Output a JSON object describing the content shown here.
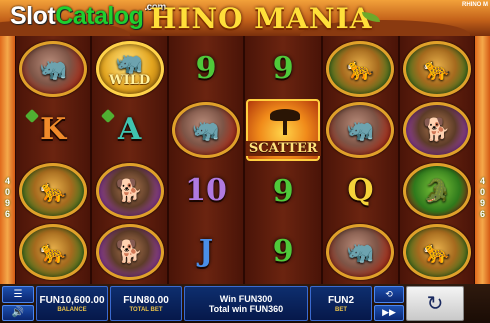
{
  "header": {
    "watermark_slot": "Slot",
    "watermark_catalog": "Catalog",
    "watermark_com": ".com",
    "game_title": "HINO MANIA",
    "corner_text": "RHINO M"
  },
  "side_numbers": {
    "left": [
      "4",
      "0",
      "9",
      "6"
    ],
    "right": [
      "4",
      "0",
      "9",
      "6"
    ]
  },
  "reels": [
    [
      {
        "kind": "coin",
        "animal": "rhino",
        "icon": "rhino-icon"
      },
      {
        "kind": "letter",
        "text": "K",
        "color": "orange"
      },
      {
        "kind": "coin",
        "animal": "leopard",
        "icon": "leopard-icon"
      },
      {
        "kind": "coin",
        "animal": "leopard",
        "icon": "leopard-icon"
      }
    ],
    [
      {
        "kind": "wild",
        "label": "WILD",
        "icon": "rhino-icon"
      },
      {
        "kind": "letter",
        "text": "A",
        "color": "teal"
      },
      {
        "kind": "coin",
        "animal": "dog",
        "icon": "wild-dog-icon"
      },
      {
        "kind": "coin",
        "animal": "dog",
        "icon": "wild-dog-icon"
      }
    ],
    [
      {
        "kind": "letter",
        "text": "9",
        "color": "green"
      },
      {
        "kind": "coin",
        "animal": "rhino",
        "icon": "rhino-icon"
      },
      {
        "kind": "letter",
        "text": "10",
        "color": "violet"
      },
      {
        "kind": "letter",
        "text": "J",
        "color": "blue"
      }
    ],
    [
      {
        "kind": "letter",
        "text": "9",
        "color": "green"
      },
      {
        "kind": "scatter",
        "label": "SCATTER",
        "icon": "acacia-tree-icon"
      },
      {
        "kind": "letter",
        "text": "9",
        "color": "green"
      },
      {
        "kind": "letter",
        "text": "9",
        "color": "green"
      }
    ],
    [
      {
        "kind": "coin",
        "animal": "leopard",
        "icon": "leopard-icon"
      },
      {
        "kind": "coin",
        "animal": "rhino",
        "icon": "rhino-icon"
      },
      {
        "kind": "letter",
        "text": "Q",
        "color": "yellow"
      },
      {
        "kind": "coin",
        "animal": "rhino",
        "icon": "rhino-icon"
      }
    ],
    [
      {
        "kind": "coin",
        "animal": "leopard",
        "icon": "leopard-icon"
      },
      {
        "kind": "coin",
        "animal": "dog",
        "icon": "wild-dog-icon"
      },
      {
        "kind": "coin",
        "animal": "croc",
        "icon": "crocodile-icon"
      },
      {
        "kind": "coin",
        "animal": "leopard",
        "icon": "leopard-icon"
      }
    ]
  ],
  "bar": {
    "balance_value": "FUN10,600.00",
    "balance_label": "BALANCE",
    "total_bet_value": "FUN80.00",
    "total_bet_label": "TOTAL BET",
    "win_line": "Win FUN300",
    "total_win_line": "Total win FUN360",
    "bet_value": "FUN2",
    "bet_label": "BET",
    "menu_icon": "hamburger-menu-icon",
    "volume_icon": "speaker-icon",
    "autoplay_icon": "repeat-icon",
    "turbo_icon": "fast-forward-icon",
    "spin_icon": "refresh-spin-icon"
  },
  "colors": {
    "orange": "#f08a2a",
    "teal": "#3fc4b0",
    "green": "#4fc93a",
    "violet": "#b07ae0",
    "blue": "#4a8fe8",
    "yellow": "#f5d33a",
    "panel_blue": "#0e2e6e",
    "title_gold": "#ffdf3a"
  }
}
